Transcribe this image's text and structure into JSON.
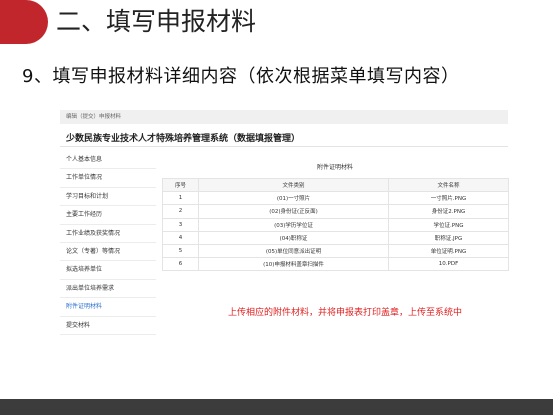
{
  "slide": {
    "title": "二、填写申报材料",
    "subtitle": "9、填写申报材料详细内容（依次根据菜单填写内容）",
    "note": "上传相应的附件材料，并将申报表打印盖章，上传至系统中"
  },
  "app": {
    "breadcrumb": "编辑（提交）申报材料",
    "system_title": "少数民族专业技术人才特殊培养管理系统（数据填报管理）",
    "sidebar": [
      {
        "label": "个人基本信息"
      },
      {
        "label": "工作单位情况"
      },
      {
        "label": "学习目标和计划"
      },
      {
        "label": "主要工作经历"
      },
      {
        "label": "工作业绩及获奖情况"
      },
      {
        "label": "论文（专著）等情况"
      },
      {
        "label": "拟选培养单位"
      },
      {
        "label": "派出单位培养需求"
      },
      {
        "label": "附件证明材料",
        "active": true
      },
      {
        "label": "提交材料"
      }
    ],
    "panel": {
      "title": "附件证明材料",
      "columns": [
        "序号",
        "文件类别",
        "文件名称"
      ],
      "rows": [
        [
          "1",
          "(01)一寸照片",
          "一寸照片.PNG"
        ],
        [
          "2",
          "(02)身份证(正反面)",
          "身份证2.PNG"
        ],
        [
          "3",
          "(03)学历学位证",
          "学位证.PNG"
        ],
        [
          "4",
          "(04)职称证",
          "职称证.JPG"
        ],
        [
          "5",
          "(05)单位同意派出证明",
          "单位证明.PNG"
        ],
        [
          "6",
          "(10)申报材料盖章扫描件",
          "10.PDF"
        ]
      ]
    }
  },
  "colors": {
    "accent_red": "#c0262c",
    "note_red": "#e02020",
    "active_blue": "#2a6fd0",
    "footer": "#3c3c3c"
  }
}
